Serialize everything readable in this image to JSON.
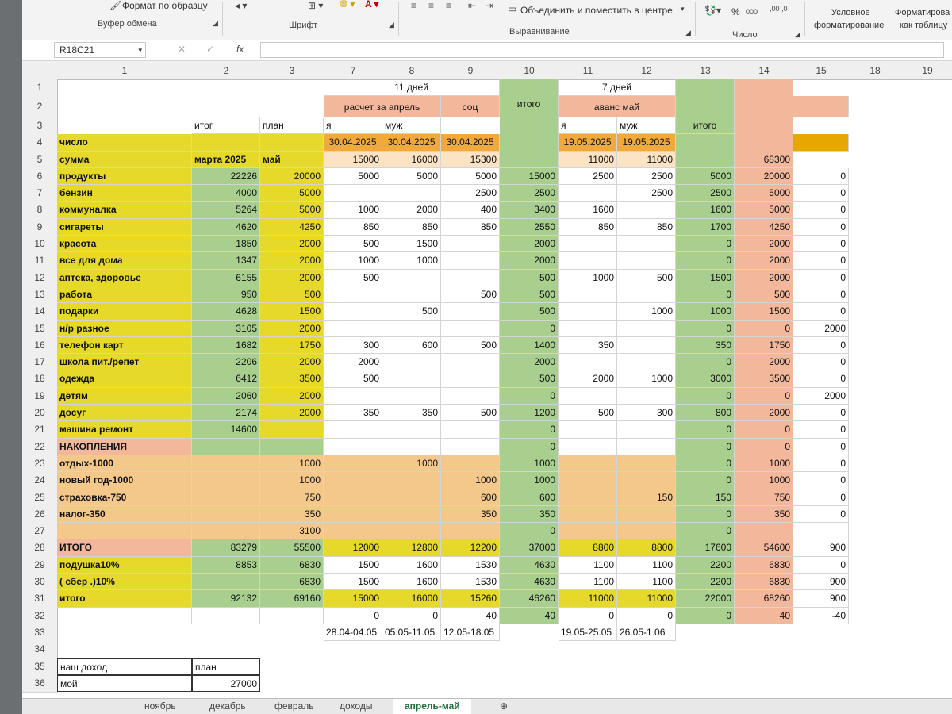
{
  "ribbon": {
    "format_painter": "Формат по образцу",
    "group_clipboard": "Буфер обмена",
    "group_font": "Шрифт",
    "merge_center": "Объединить и поместить в центре",
    "group_alignment": "Выравнивание",
    "percent": "%",
    "thousands": "000",
    "group_number": "Число",
    "conditional_line1": "Условное",
    "conditional_line2": "форматирование",
    "format_table_line1": "Форматирова",
    "format_table_line2": "как таблицу"
  },
  "formula_bar": {
    "name_box": "R18C21",
    "fx": "fx",
    "formula": ""
  },
  "columns": [
    "1",
    "2",
    "3",
    "7",
    "8",
    "9",
    "10",
    "11",
    "12",
    "13",
    "14",
    "15",
    "18",
    "19"
  ],
  "rows": [
    "1",
    "2",
    "3",
    "4",
    "5",
    "6",
    "7",
    "8",
    "9",
    "10",
    "11",
    "12",
    "13",
    "14",
    "15",
    "16",
    "17",
    "18",
    "19",
    "20",
    "21",
    "22",
    "23",
    "24",
    "25",
    "26",
    "27",
    "28",
    "29",
    "30",
    "31",
    "32",
    "33",
    "34",
    "35",
    "36"
  ],
  "headers": {
    "days11": "11 дней",
    "days7": "7 дней",
    "rasschet": "расчет за апрель",
    "soc": "соц",
    "itogo10": "итого",
    "avans": "аванс май",
    "itogo13": "итого",
    "itog": "итог",
    "plan": "план",
    "ya1": "я",
    "muzh1": "муж",
    "ya2": "я",
    "muzh2": "муж",
    "chislo": "число",
    "summa": "сумма",
    "marta": "марта 2025",
    "may": "май",
    "date7": "30.04.2025",
    "date8": "30.04.2025",
    "date9": "30.04.2025",
    "date11": "19.05.2025",
    "date12": "19.05.2025",
    "sum7": "15000",
    "sum8": "16000",
    "sum9": "15300",
    "sum11": "11000",
    "sum12": "11000",
    "sum14": "68300"
  },
  "table": [
    [
      "продукты",
      "22226",
      "20000",
      "5000",
      "5000",
      "5000",
      "15000",
      "2500",
      "2500",
      "5000",
      "20000",
      "0"
    ],
    [
      "бензин",
      "4000",
      "5000",
      "",
      "",
      "2500",
      "2500",
      "",
      "2500",
      "2500",
      "5000",
      "0"
    ],
    [
      "коммуналка",
      "5264",
      "5000",
      "1000",
      "2000",
      "400",
      "3400",
      "1600",
      "",
      "1600",
      "5000",
      "0"
    ],
    [
      "сигареты",
      "4620",
      "4250",
      "850",
      "850",
      "850",
      "2550",
      "850",
      "850",
      "1700",
      "4250",
      "0"
    ],
    [
      "красота",
      "1850",
      "2000",
      "500",
      "1500",
      "",
      "2000",
      "",
      "",
      "0",
      "2000",
      "0"
    ],
    [
      "все для дома",
      "1347",
      "2000",
      "1000",
      "1000",
      "",
      "2000",
      "",
      "",
      "0",
      "2000",
      "0"
    ],
    [
      "аптека, здоровье",
      "6155",
      "2000",
      "500",
      "",
      "",
      "500",
      "1000",
      "500",
      "1500",
      "2000",
      "0"
    ],
    [
      "работа",
      "950",
      "500",
      "",
      "",
      "500",
      "500",
      "",
      "",
      "0",
      "500",
      "0"
    ],
    [
      "подарки",
      "4628",
      "1500",
      "",
      "500",
      "",
      "500",
      "",
      "1000",
      "1000",
      "1500",
      "0"
    ],
    [
      "н/р разное",
      "3105",
      "2000",
      "",
      "",
      "",
      "0",
      "",
      "",
      "0",
      "0",
      "2000"
    ],
    [
      "телефон карт",
      "1682",
      "1750",
      "300",
      "600",
      "500",
      "1400",
      "350",
      "",
      "350",
      "1750",
      "0"
    ],
    [
      "школа пит./репет",
      "2206",
      "2000",
      "2000",
      "",
      "",
      "2000",
      "",
      "",
      "0",
      "2000",
      "0"
    ],
    [
      "одежда",
      "6412",
      "3500",
      "500",
      "",
      "",
      "500",
      "2000",
      "1000",
      "3000",
      "3500",
      "0"
    ],
    [
      "детям",
      "2060",
      "2000",
      "",
      "",
      "",
      "0",
      "",
      "",
      "0",
      "0",
      "2000"
    ],
    [
      "досуг",
      "2174",
      "2000",
      "350",
      "350",
      "500",
      "1200",
      "500",
      "300",
      "800",
      "2000",
      "0"
    ],
    [
      "машина ремонт",
      "14600",
      "",
      "",
      "",
      "",
      "0",
      "",
      "",
      "0",
      "0",
      "0"
    ],
    [
      "НАКОПЛЕНИЯ",
      "",
      "",
      "",
      "",
      "",
      "0",
      "",
      "",
      "0",
      "0",
      "0"
    ],
    [
      "отдых-1000",
      "",
      "1000",
      "",
      "1000",
      "",
      "1000",
      "",
      "",
      "0",
      "1000",
      "0"
    ],
    [
      "новый год-1000",
      "",
      "1000",
      "",
      "",
      "1000",
      "1000",
      "",
      "",
      "0",
      "1000",
      "0"
    ],
    [
      "страховка-750",
      "",
      "750",
      "",
      "",
      "600",
      "600",
      "",
      "150",
      "150",
      "750",
      "0"
    ],
    [
      "налог-350",
      "",
      "350",
      "",
      "",
      "350",
      "350",
      "",
      "",
      "0",
      "350",
      "0"
    ],
    [
      "",
      "",
      "3100",
      "",
      "",
      "",
      "0",
      "",
      "",
      "0",
      "",
      ""
    ],
    [
      "ИТОГО",
      "83279",
      "55500",
      "12000",
      "12800",
      "12200",
      "37000",
      "8800",
      "8800",
      "17600",
      "54600",
      "900"
    ],
    [
      "подушка10%",
      "8853",
      "6830",
      "1500",
      "1600",
      "1530",
      "4630",
      "1100",
      "1100",
      "2200",
      "6830",
      "0"
    ],
    [
      "( сбер .)10%",
      "",
      "6830",
      "1500",
      "1600",
      "1530",
      "4630",
      "1100",
      "1100",
      "2200",
      "6830",
      "900"
    ],
    [
      "итого",
      "92132",
      "69160",
      "15000",
      "16000",
      "15260",
      "46260",
      "11000",
      "11000",
      "22000",
      "68260",
      "900"
    ],
    [
      "",
      "",
      "",
      "0",
      "0",
      "40",
      "40",
      "0",
      "0",
      "0",
      "40",
      "-40"
    ]
  ],
  "footer": {
    "range1": "28.04-04.05",
    "range2": "05.05-11.05",
    "range3": "12.05-18.05",
    "range4": "19.05-25.05",
    "range5": "26.05-1.06",
    "income_label": "наш доход",
    "income_plan": "план",
    "moy_label": "мой",
    "moy_value": "27000"
  },
  "sheet_tabs": [
    "ноябрь",
    "декабрь",
    "февраль",
    "доходы",
    "апрель-май"
  ],
  "active_tab": "апрель-май",
  "colors": {
    "yellow": "#e6d92a",
    "green": "#a9cf8f",
    "salmon": "#f3b89c",
    "orange_light": "#f4c88a",
    "peach": "#fbe3c4",
    "accent_green": "#1e6e3c"
  }
}
